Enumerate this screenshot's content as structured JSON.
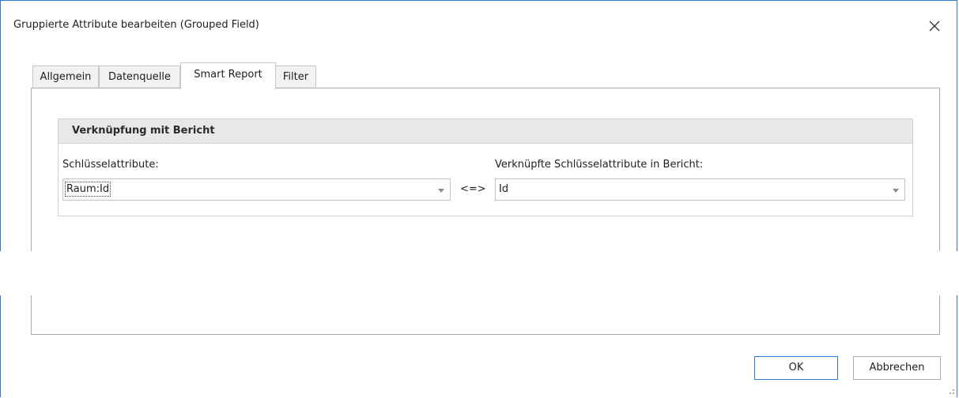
{
  "window": {
    "title": "Gruppierte Attribute bearbeiten (Grouped Field)",
    "accent_color": "#2b79d7"
  },
  "tabs": [
    {
      "label": "Allgemein",
      "active": false
    },
    {
      "label": "Datenquelle",
      "active": false
    },
    {
      "label": "Smart Report",
      "active": true
    },
    {
      "label": "Filter",
      "active": false
    }
  ],
  "group": {
    "title": "Verknüpfung mit Bericht",
    "key_label": "Schlüsselattribute:",
    "key_value": "Raum:Id",
    "operator": "<=>",
    "linked_label": "Verknüpfte Schlüsselattribute in Bericht:",
    "linked_value": "Id"
  },
  "buttons": {
    "ok": "OK",
    "cancel": "Abbrechen"
  },
  "icons": {
    "close": "close-icon",
    "dropdown": "chevron-down-icon",
    "resize": "resize-grip-icon"
  }
}
